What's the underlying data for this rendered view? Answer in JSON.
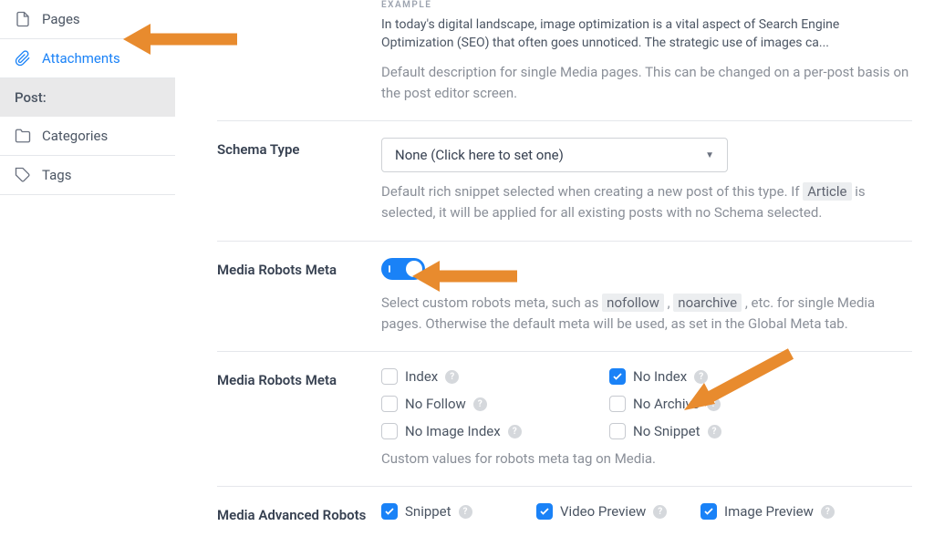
{
  "sidebar": {
    "items": [
      {
        "id": "pages",
        "label": "Pages",
        "active": false
      },
      {
        "id": "attachments",
        "label": "Attachments",
        "active": true
      }
    ],
    "heading": "Post:",
    "post_items": [
      {
        "id": "categories",
        "label": "Categories"
      },
      {
        "id": "tags",
        "label": "Tags"
      }
    ]
  },
  "description_section": {
    "example_label": "EXAMPLE",
    "example_text": "In today's digital landscape, image optimization is a vital aspect of Search Engine Optimization (SEO) that often goes unnoticed. The strategic use of images ca...",
    "help": "Default description for single Media pages. This can be changed on a per-post basis on the post editor screen."
  },
  "schema": {
    "label": "Schema Type",
    "select_value": "None (Click here to set one)",
    "help_pre": "Default rich snippet selected when creating a new post of this type. If ",
    "help_code": "Article",
    "help_post": " is selected, it will be applied for all existing posts with no Schema selected."
  },
  "robots_toggle": {
    "label": "Media Robots Meta",
    "enabled": true,
    "help_pre": "Select custom robots meta, such as ",
    "code1": "nofollow",
    "sep": " , ",
    "code2": "noarchive",
    "help_post": " , etc. for single Media pages. Otherwise the default meta will be used, as set in the Global Meta tab."
  },
  "robots_checks": {
    "label": "Media Robots Meta",
    "options": [
      {
        "label": "Index",
        "checked": false
      },
      {
        "label": "No Index",
        "checked": true
      },
      {
        "label": "No Follow",
        "checked": false
      },
      {
        "label": "No Archive",
        "checked": false
      },
      {
        "label": "No Image Index",
        "checked": false
      },
      {
        "label": "No Snippet",
        "checked": false
      }
    ],
    "help": "Custom values for robots meta tag on Media."
  },
  "advanced": {
    "label": "Media Advanced Robots",
    "options": [
      {
        "label": "Snippet",
        "checked": true
      },
      {
        "label": "Video Preview",
        "checked": true
      },
      {
        "label": "Image Preview",
        "checked": true
      }
    ]
  }
}
